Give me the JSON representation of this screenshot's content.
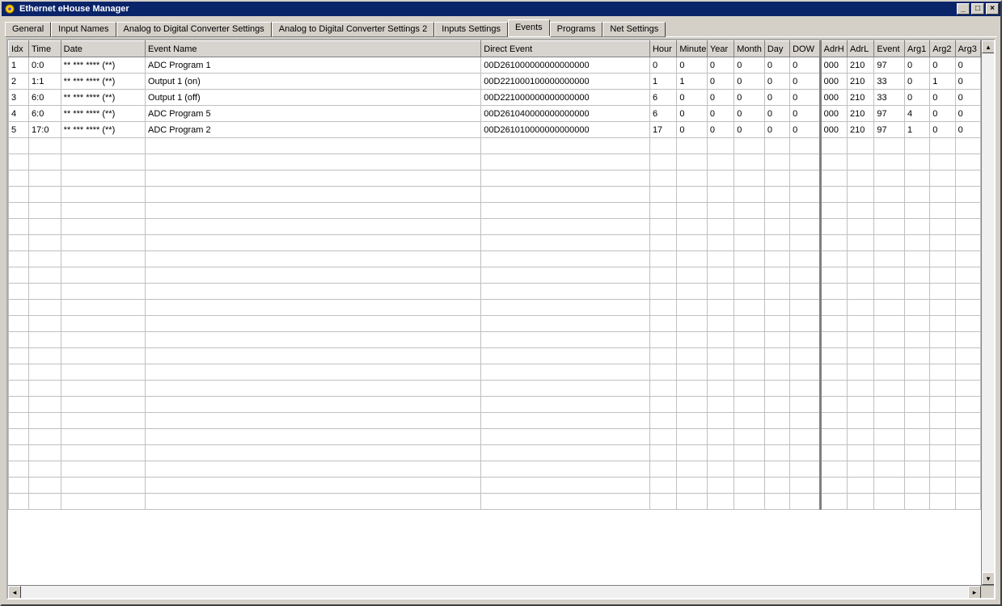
{
  "window": {
    "title": "Ethernet eHouse Manager"
  },
  "tabs": [
    {
      "label": "General",
      "active": false
    },
    {
      "label": "Input Names",
      "active": false
    },
    {
      "label": "Analog to Digital Converter Settings",
      "active": false
    },
    {
      "label": "Analog to Digital Converter Settings 2",
      "active": false
    },
    {
      "label": "Inputs Settings",
      "active": false
    },
    {
      "label": "Events",
      "active": true
    },
    {
      "label": "Programs",
      "active": false
    },
    {
      "label": "Net Settings",
      "active": false
    }
  ],
  "grid": {
    "columns": [
      {
        "key": "idx",
        "label": "Idx",
        "cls": "col-idx"
      },
      {
        "key": "time",
        "label": "Time",
        "cls": "col-time"
      },
      {
        "key": "date",
        "label": "Date",
        "cls": "col-date"
      },
      {
        "key": "name",
        "label": "Event Name",
        "cls": "col-name"
      },
      {
        "key": "direct",
        "label": "Direct Event",
        "cls": "col-direct"
      },
      {
        "key": "hour",
        "label": "Hour",
        "cls": "col-hour"
      },
      {
        "key": "minute",
        "label": "Minute",
        "cls": "col-min"
      },
      {
        "key": "year",
        "label": "Year",
        "cls": "col-year"
      },
      {
        "key": "month",
        "label": "Month",
        "cls": "col-month"
      },
      {
        "key": "day",
        "label": "Day",
        "cls": "col-day"
      },
      {
        "key": "dow",
        "label": "DOW",
        "cls": "col-dow"
      },
      {
        "key": "adrh",
        "label": "AdrH",
        "cls": "col-adrh",
        "sep": true
      },
      {
        "key": "adrl",
        "label": "AdrL",
        "cls": "col-adrl"
      },
      {
        "key": "event",
        "label": "Event",
        "cls": "col-event"
      },
      {
        "key": "arg1",
        "label": "Arg1",
        "cls": "col-arg1"
      },
      {
        "key": "arg2",
        "label": "Arg2",
        "cls": "col-arg2"
      },
      {
        "key": "arg3",
        "label": "Arg3",
        "cls": "col-arg3"
      }
    ],
    "rows": [
      {
        "idx": "1",
        "time": "0:0",
        "date": "** *** **** (**)",
        "name": "ADC Program 1",
        "direct": "00D261000000000000000",
        "hour": "0",
        "minute": "0",
        "year": "0",
        "month": "0",
        "day": "0",
        "dow": "0",
        "adrh": "000",
        "adrl": "210",
        "event": "97",
        "arg1": "0",
        "arg2": "0",
        "arg3": "0"
      },
      {
        "idx": "2",
        "time": "1:1",
        "date": "** *** **** (**)",
        "name": "Output 1 (on)",
        "direct": "00D221000100000000000",
        "hour": "1",
        "minute": "1",
        "year": "0",
        "month": "0",
        "day": "0",
        "dow": "0",
        "adrh": "000",
        "adrl": "210",
        "event": "33",
        "arg1": "0",
        "arg2": "1",
        "arg3": "0"
      },
      {
        "idx": "3",
        "time": "6:0",
        "date": "** *** **** (**)",
        "name": "Output 1 (off)",
        "direct": "00D221000000000000000",
        "hour": "6",
        "minute": "0",
        "year": "0",
        "month": "0",
        "day": "0",
        "dow": "0",
        "adrh": "000",
        "adrl": "210",
        "event": "33",
        "arg1": "0",
        "arg2": "0",
        "arg3": "0"
      },
      {
        "idx": "4",
        "time": "6:0",
        "date": "** *** **** (**)",
        "name": "ADC Program 5",
        "direct": "00D261040000000000000",
        "hour": "6",
        "minute": "0",
        "year": "0",
        "month": "0",
        "day": "0",
        "dow": "0",
        "adrh": "000",
        "adrl": "210",
        "event": "97",
        "arg1": "4",
        "arg2": "0",
        "arg3": "0"
      },
      {
        "idx": "5",
        "time": "17:0",
        "date": "** *** **** (**)",
        "name": "ADC Program 2",
        "direct": "00D261010000000000000",
        "hour": "17",
        "minute": "0",
        "year": "0",
        "month": "0",
        "day": "0",
        "dow": "0",
        "adrh": "000",
        "adrl": "210",
        "event": "97",
        "arg1": "1",
        "arg2": "0",
        "arg3": "0"
      }
    ],
    "empty_rows": 23,
    "focused": {
      "row": 4,
      "col": "name"
    }
  }
}
